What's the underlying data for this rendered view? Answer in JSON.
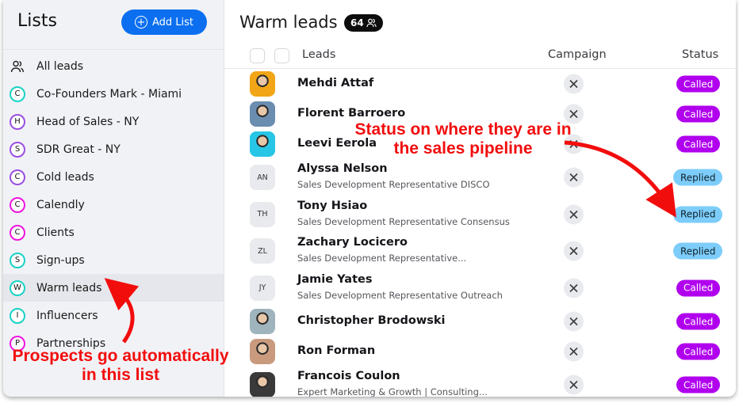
{
  "sidebar": {
    "title": "Lists",
    "add_button": "Add List",
    "items": [
      {
        "label": "All leads",
        "letter": "",
        "icon": "users-icon",
        "color": ""
      },
      {
        "label": "Co-Founders Mark - Miami",
        "letter": "C",
        "color": "#19d3c5"
      },
      {
        "label": "Head of Sales - NY",
        "letter": "H",
        "color": "#9b4fe0"
      },
      {
        "label": "SDR Great - NY",
        "letter": "S",
        "color": "#9b4fe0"
      },
      {
        "label": "Cold leads",
        "letter": "C",
        "color": "#9b4fe0"
      },
      {
        "label": "Calendly",
        "letter": "C",
        "color": "#f015e0"
      },
      {
        "label": "Clients",
        "letter": "C",
        "color": "#f015e0"
      },
      {
        "label": "Sign-ups",
        "letter": "S",
        "color": "#19d3c5"
      },
      {
        "label": "Warm leads",
        "letter": "W",
        "color": "#19d3c5",
        "active": true
      },
      {
        "label": "Influencers",
        "letter": "I",
        "color": "#19d3c5"
      },
      {
        "label": "Partnerships",
        "letter": "P",
        "color": "#f015e0"
      }
    ]
  },
  "main": {
    "title": "Warm leads",
    "count": "64",
    "columns": {
      "leads": "Leads",
      "campaign": "Campaign",
      "status": "Status"
    },
    "rows": [
      {
        "name": "Mehdi Attaf",
        "subtitle": "",
        "initials": "",
        "photo": "#f2a516",
        "status": "Called"
      },
      {
        "name": "Florent Barroero",
        "subtitle": "",
        "initials": "",
        "photo": "#6b8db0",
        "status": "Called"
      },
      {
        "name": "Leevi Eerola",
        "subtitle": "",
        "initials": "",
        "photo": "#27c6e6",
        "status": "Called"
      },
      {
        "name": "Alyssa Nelson",
        "subtitle": "Sales Development Representative DISCO",
        "initials": "AN",
        "status": "Replied"
      },
      {
        "name": "Tony Hsiao",
        "subtitle": "Sales Development Representative Consensus",
        "initials": "TH",
        "status": "Replied"
      },
      {
        "name": "Zachary Locicero",
        "subtitle": "Sales Development Representative...",
        "initials": "ZL",
        "status": "Replied"
      },
      {
        "name": "Jamie Yates",
        "subtitle": "Sales Development Representative Outreach",
        "initials": "JY",
        "status": "Called"
      },
      {
        "name": "Christopher Brodowski",
        "subtitle": "",
        "initials": "",
        "photo": "#9fb4bd",
        "status": "Called"
      },
      {
        "name": "Ron Forman",
        "subtitle": "",
        "initials": "",
        "photo": "#c99a7d",
        "status": "Called"
      },
      {
        "name": "Francois Coulon",
        "subtitle": "Expert Marketing & Growth | Consulting...",
        "initials": "",
        "photo": "#3a3a3a",
        "status": "Called"
      }
    ],
    "status_colors": {
      "Called": "#b000ee",
      "Replied": "#7dcdfa"
    }
  },
  "annotations": {
    "status_note": "Status on where they are in the sales pipeline",
    "list_note": "Prospects go automatically in this list"
  }
}
